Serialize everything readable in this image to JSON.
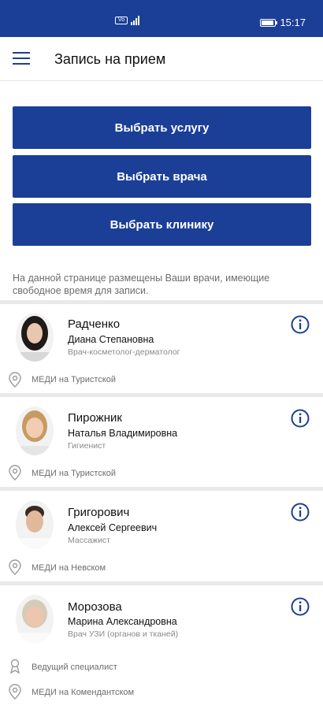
{
  "status_bar": {
    "network_label": "Vo LTE",
    "time": "15:17"
  },
  "header": {
    "title": "Запись на прием"
  },
  "actions": {
    "select_service": "Выбрать услугу",
    "select_doctor": "Выбрать врача",
    "select_clinic": "Выбрать клинику"
  },
  "info_text": "На данной странице размещены Ваши врачи, имеющие свободное время для записи.",
  "doctors": [
    {
      "last_name": "Радченко",
      "full_name": "Диана Степановна",
      "position": "Врач-косметолог-дерматолог",
      "clinic": "МЕДИ на Туристской"
    },
    {
      "last_name": "Пирожник",
      "full_name": "Наталья Владимировна",
      "position": "Гигиенист",
      "clinic": "МЕДИ на Туристской"
    },
    {
      "last_name": "Григорович",
      "full_name": "Алексей Сергеевич",
      "position": "Массажист",
      "clinic": "МЕДИ на Невском"
    },
    {
      "last_name": "Морозова",
      "full_name": "Марина Александровна",
      "position": "Врач УЗИ (органов и тканей)",
      "extra": "Ведущий специалист",
      "clinic": "МЕДИ на Комендантском"
    }
  ],
  "colors": {
    "primary": "#1b3f97",
    "separator": "#e9e9e9",
    "muted_text": "#6d6d6d"
  },
  "icons": {
    "menu": "hamburger-menu-icon",
    "info": "info-circle-icon",
    "location": "location-pin-icon",
    "badge": "specialist-badge-icon"
  }
}
